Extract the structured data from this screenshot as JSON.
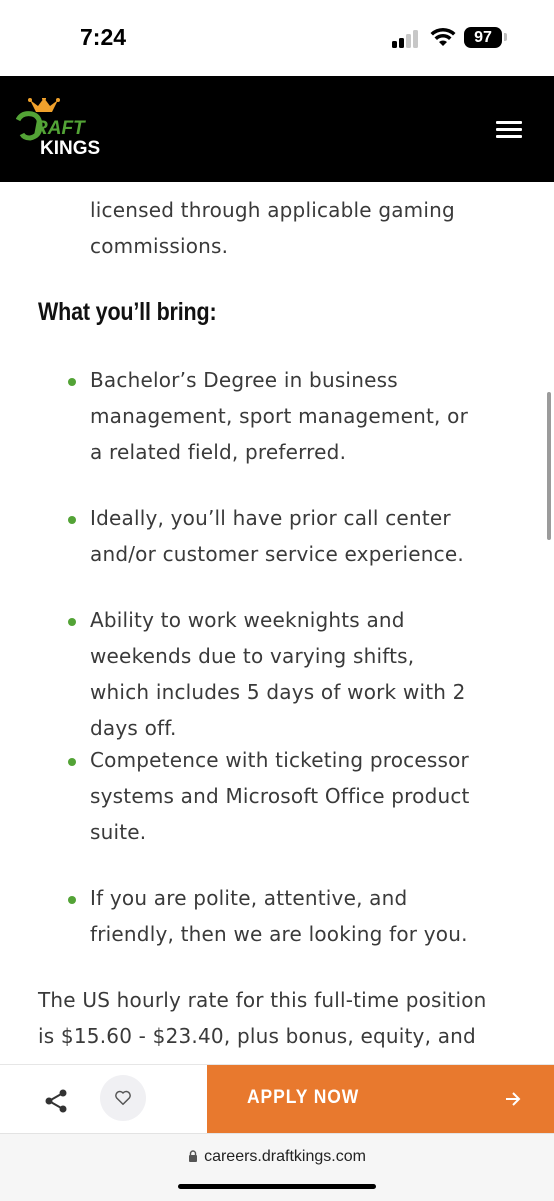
{
  "status_bar": {
    "time": "7:24",
    "battery": "97"
  },
  "header": {
    "logo_text_top": "DRAFT",
    "logo_text_bottom": "KINGS"
  },
  "content": {
    "cut_line": "",
    "continued_paragraph": "licensed through applicable gaming commissions.",
    "section_heading": "What you’ll bring:",
    "bullets": [
      "Bachelor’s Degree in business management, sport management, or a related field, preferred.",
      "Ideally, you’ll have prior call center and/or customer service experience.",
      "Ability to work weeknights and weekends due to varying shifts, which includes 5 days of work with 2 days off.",
      "Competence with ticketing processor systems and Microsoft Office product suite.",
      "If you are polite, attentive, and friendly, then we are looking for you."
    ],
    "salary_paragraph": "The US hourly rate for this full-time position is $15.60 - $23.40, plus bonus, equity, and"
  },
  "action_bar": {
    "apply_label": "APPLY NOW"
  },
  "url_bar": {
    "url": "careers.draftkings.com"
  },
  "colors": {
    "accent_orange": "#e8792e",
    "bullet_green": "#53a336",
    "header_bg": "#000000"
  },
  "icons": [
    "share-icon",
    "heart-icon",
    "arrow-right-icon",
    "menu-icon",
    "lock-icon",
    "wifi-icon",
    "signal-icon"
  ]
}
